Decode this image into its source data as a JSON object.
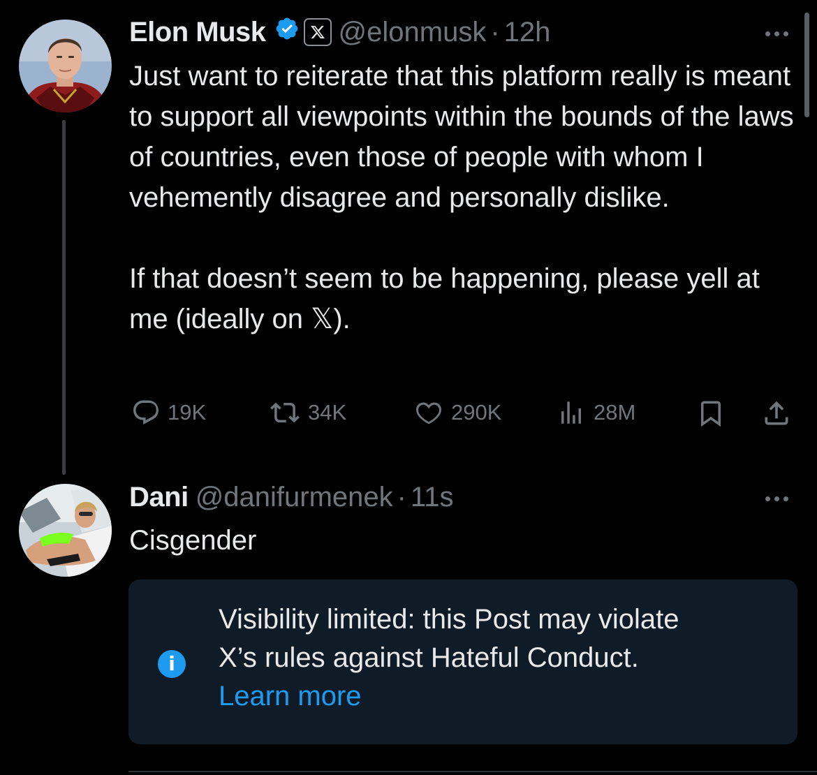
{
  "tweet1": {
    "display_name": "Elon Musk",
    "verified_icon": "verified-badge-icon",
    "affiliate_icon": "x-logo-icon",
    "handle": "@elonmusk",
    "separator": "·",
    "time": "12h",
    "paragraphs": [
      "Just want to reiterate that this platform really is meant to support all viewpoints within the bounds of the laws of countries, even those of people with whom I vehemently disagree and personally dislike.",
      "If that doesn’t seem to be happening, please yell at me (ideally on 𝕏)."
    ],
    "actions": {
      "replies": "19K",
      "reposts": "34K",
      "likes": "290K",
      "views": "28M"
    }
  },
  "tweet2": {
    "display_name": "Dani",
    "handle": "@danifurmenek",
    "separator": "·",
    "time": "11s",
    "text": "Cisgender"
  },
  "notice": {
    "line1": "Visibility limited: this Post may violate",
    "line2": "X’s rules against Hateful Conduct.",
    "link": "Learn more"
  },
  "colors": {
    "background": "#000000",
    "text_primary": "#e7e9ea",
    "text_secondary": "#71767b",
    "accent": "#1d9bf0",
    "notice_bg": "#0f1b26"
  }
}
